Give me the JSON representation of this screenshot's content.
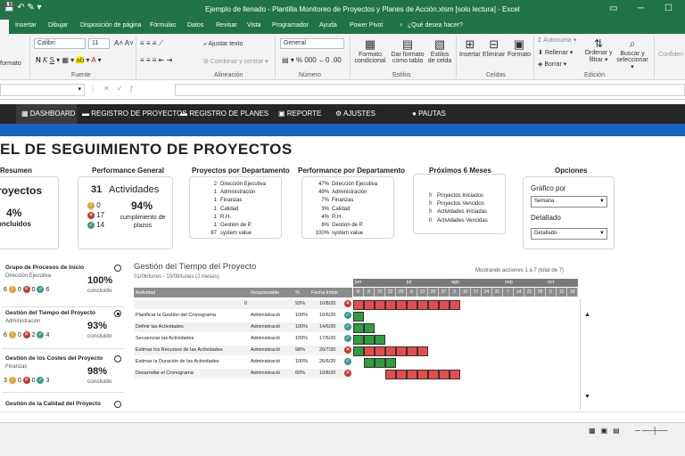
{
  "window": {
    "title": "Ejemplo de llenado - Plantilla Monitoreo de Proyectos y Planes de Acción.xlsm  [solo lectura]  -  Excel"
  },
  "ribbon_tabs": [
    "Insertar",
    "Dibujar",
    "Disposición de página",
    "Fórmulas",
    "Datos",
    "Revisar",
    "Vista",
    "Programador",
    "Ayuda",
    "Power Pivot",
    "¿Qué desea hacer?"
  ],
  "ribbon": {
    "font_name": "Calibri",
    "font_size": "11",
    "number_format": "General",
    "wrap": "Ajustar texto",
    "merge": "Combinar y centrar",
    "format_label": "formato",
    "cond_format": "Formato condicional",
    "table_format": "Dar formato como tabla",
    "cell_styles": "Estilos de celda",
    "insert": "Insertar",
    "delete": "Eliminar",
    "format": "Formato",
    "autosum": "Autosuma",
    "fill": "Rellenar",
    "clear": "Borrar",
    "sort": "Ordenar y filtrar",
    "find": "Buscar y seleccionar",
    "conf": "Confiden",
    "g_fuente": "Fuente",
    "g_alin": "Alineación",
    "g_num": "Número",
    "g_est": "Estilos",
    "g_cel": "Celdas",
    "g_edi": "Edición"
  },
  "nav": [
    "DASHBOARD",
    "REGISTRO DE PROYECTOS",
    "REGISTRO DE PLANES",
    "REPORTE",
    "AJUSTES",
    "PAUTAS"
  ],
  "page_title": "EL DE SEGUIMIENTO DE PROYECTOS",
  "summary": {
    "header": "Resumen",
    "projects": "royectos",
    "pct": "4%",
    "concl": "oncluidos"
  },
  "performance": {
    "header": "Performance General",
    "count": "31",
    "label": "Actividades",
    "c0": "0",
    "c17": "17",
    "c14": "14",
    "pct": "94%",
    "pct_label1": "cumplimiento de",
    "pct_label2": "plazos"
  },
  "by_dept": {
    "header": "Proyectos por Departamento",
    "rows": [
      {
        "n": "2",
        "name": "Dirección Ejecutiva"
      },
      {
        "n": "1",
        "name": "Administración"
      },
      {
        "n": "1",
        "name": "Finanzas"
      },
      {
        "n": "1",
        "name": "Calidad"
      },
      {
        "n": "1",
        "name": "R.H."
      },
      {
        "n": "1",
        "name": "Gestión de P."
      },
      {
        "n": "87",
        "name": "system value"
      }
    ]
  },
  "perf_dept": {
    "header": "Performance por Departamento",
    "rows": [
      {
        "n": "47%",
        "name": "Dirección Ejecutiva"
      },
      {
        "n": "49%",
        "name": "Administración"
      },
      {
        "n": "7%",
        "name": "Finanzas"
      },
      {
        "n": "3%",
        "name": "Calidad"
      },
      {
        "n": "4%",
        "name": "R.H."
      },
      {
        "n": "6%",
        "name": "Gestión de P."
      },
      {
        "n": "100%",
        "name": "system value"
      }
    ]
  },
  "next6": {
    "header": "Próximos 6 Meses",
    "rows": [
      {
        "n": "0",
        "name": "Proyectos Iniciados"
      },
      {
        "n": "0",
        "name": "Proyectos Vencidos"
      },
      {
        "n": "0",
        "name": "Actividades Iniciadas"
      },
      {
        "n": "0",
        "name": "Actividades Vencidas"
      }
    ]
  },
  "options": {
    "header": "Opciones",
    "graph_label": "Gráfico por",
    "graph_value": "Semana",
    "detail_label": "Detallado",
    "detail_value": "Detallado"
  },
  "processes": [
    {
      "title": "Grupo de Procesos de Inicio",
      "sub": "Dirección Ejecutiva",
      "a": "6",
      "b": "0",
      "c": "0",
      "d": "6",
      "pct": "100%",
      "status": "concluido",
      "selected": false
    },
    {
      "title": "Gestión del Tiempo del Proyecto",
      "sub": "Administración",
      "a": "6",
      "b": "0",
      "c": "2",
      "d": "4",
      "pct": "93%",
      "status": "concluido",
      "selected": true
    },
    {
      "title": "Gestión de los Costes del Proyecto",
      "sub": "Finanzas",
      "a": "3",
      "b": "0",
      "c": "0",
      "d": "3",
      "pct": "98%",
      "status": "concluido",
      "selected": false
    },
    {
      "title": "Gestión de la Calidad del Proyecto",
      "sub": "",
      "a": "",
      "b": "",
      "c": "",
      "d": "",
      "pct": "",
      "status": "",
      "selected": false
    }
  ],
  "gantt": {
    "title": "Gestión del Tiempo del Proyecto",
    "dates": "01/06/lunes - 10/08/lunes (2 meses)",
    "showing": "Mostrando acciones 1 a 7 (total de 7)",
    "months": [
      "jun",
      "jul",
      "ago",
      "sep",
      "oct"
    ],
    "weeks": [
      "8",
      "8",
      "15",
      "22",
      "29",
      "6",
      "13",
      "20",
      "27",
      "3",
      "10",
      "17",
      "24",
      "31",
      "7",
      "14",
      "21",
      "28",
      "5",
      "12",
      "19"
    ],
    "headers": [
      "Actividad",
      "Responsable",
      "%",
      "Fecha límite"
    ],
    "rows": [
      {
        "act": "",
        "resp": "0",
        "pct": "93%",
        "date": "10/8/20"
      },
      {
        "act": "Planificar la Gestión del Cronograma",
        "resp": "Administració",
        "pct": "100%",
        "date": "10/6/20"
      },
      {
        "act": "Definir las Actividades",
        "resp": "Administració",
        "pct": "100%",
        "date": "14/6/20"
      },
      {
        "act": "Secuenciar las Actividades",
        "resp": "Administració",
        "pct": "100%",
        "date": "17/6/20"
      },
      {
        "act": "Estimar los Recursos de las Actividades",
        "resp": "Administració",
        "pct": "98%",
        "date": "20/7/20"
      },
      {
        "act": "Estimar la Duración de las Actividades",
        "resp": "Administració",
        "pct": "100%",
        "date": "26/6/20"
      },
      {
        "act": "Desarrollar el Cronograma",
        "resp": "Administració",
        "pct": "60%",
        "date": "10/8/20"
      }
    ]
  },
  "colors": {
    "excel_green": "#217346",
    "nav_dark": "#262626",
    "nav_blue": "#1565c0",
    "bar_red": "#e84b4b",
    "bar_green": "#2e9e3e"
  }
}
